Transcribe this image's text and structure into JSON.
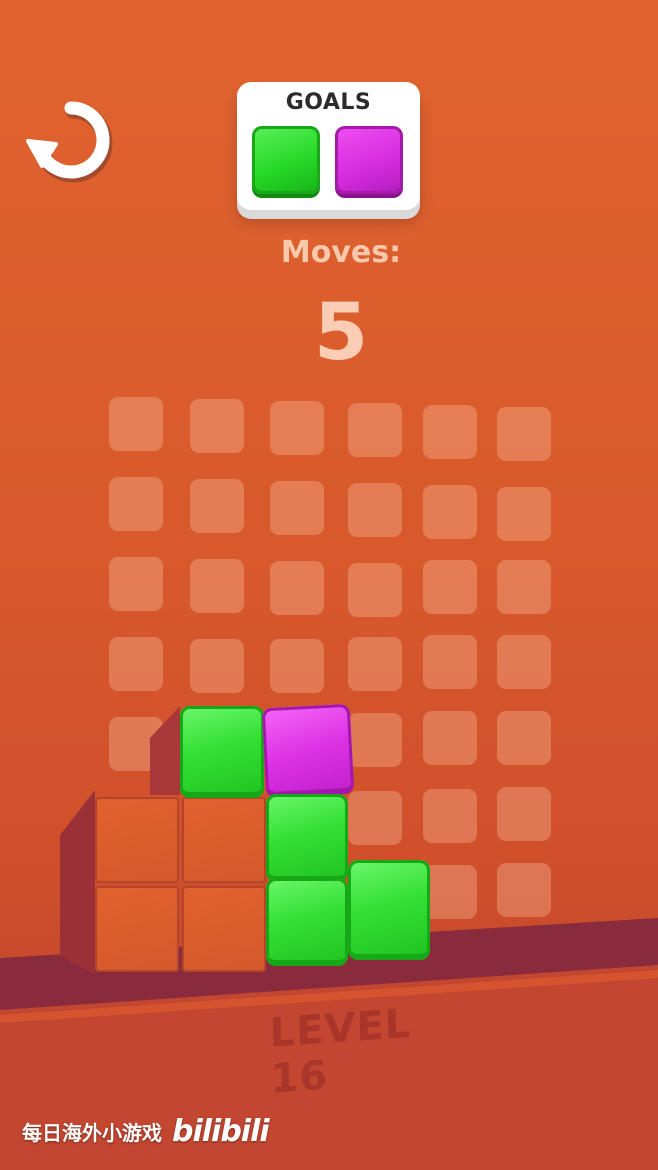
{
  "header": {
    "goals_title": "GOALS",
    "goal_tiles": [
      {
        "color_name": "green",
        "color": "#2ee02e"
      },
      {
        "color_name": "magenta",
        "color": "#d92ee2"
      }
    ],
    "restart_icon": "restart-icon"
  },
  "moves": {
    "label": "Moves:",
    "count": "5"
  },
  "board": {
    "grid_rows": 7,
    "grid_cols": 6,
    "blocks": [
      {
        "color": "green"
      },
      {
        "color": "magenta"
      },
      {
        "color": "green"
      },
      {
        "color": "green"
      },
      {
        "color": "green"
      }
    ]
  },
  "level": {
    "label": "LEVEL 16"
  },
  "watermark": {
    "text": "每日海外小游戏",
    "logo": "bilibili"
  },
  "colors": {
    "background": "#d85a2c",
    "floor": "#86283a",
    "green": "#2ee02e",
    "magenta": "#d92ee2"
  }
}
